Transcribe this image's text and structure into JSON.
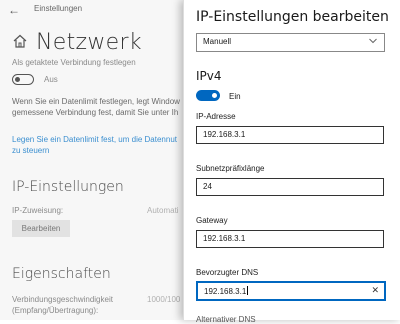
{
  "window": {
    "title": "Einstellungen"
  },
  "page": {
    "title": "Netzwerk",
    "metered_label": "Als getaktete Verbindung festlegen",
    "metered_toggle_state": "Aus",
    "paragraph_lines": [
      "Wenn Sie ein Datenlimit festlegen, legt Window",
      "gemessene Verbindung fest, damit Sie unter Ih"
    ],
    "link_lines": [
      "Legen Sie ein Datenlimit fest, um die Datennut",
      "zu steuern"
    ],
    "ip_section_title": "IP-Einstellungen",
    "ip_assignment_label": "IP-Zuweisung:",
    "ip_assignment_value": "Automati",
    "edit_button": "Bearbeiten",
    "properties_title": "Eigenschaften",
    "speed_label_lines": [
      "Verbindungsgeschwindigkeit",
      "(Empfang/Übertragung):"
    ],
    "speed_value": "1000/100"
  },
  "dialog": {
    "title": "IP-Einstellungen bearbeiten",
    "mode_select": "Manuell",
    "ipv4_heading": "IPv4",
    "ipv4_toggle_state": "Ein",
    "fields": [
      {
        "label": "IP-Adresse",
        "value": "192.168.3.1"
      },
      {
        "label": "Subnetzpräfixlänge",
        "value": "24"
      },
      {
        "label": "Gateway",
        "value": "192.168.3.1"
      },
      {
        "label": "Bevorzugter DNS",
        "value": "192.168.3.1"
      }
    ],
    "next_label_partial": "Alternativer DNS"
  },
  "colors": {
    "accent": "#0067c0",
    "link": "#3b8fd0"
  }
}
